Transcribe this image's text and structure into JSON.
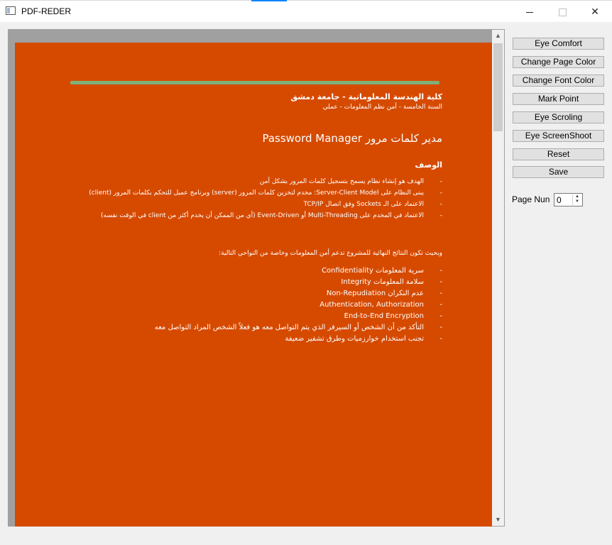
{
  "window": {
    "title": "PDF-REDER",
    "minimize_icon": "minimize-icon",
    "maximize_icon": "maximize-icon",
    "close_icon": "close-icon",
    "close_glyph": "✕"
  },
  "document": {
    "university": "كلية الهندسة المعلوماتية - جامعة دمشق",
    "year": "السنة الخامسة - أمن نظم المعلومات - عملي",
    "title": "مدير كلمات مرور Password Manager",
    "section_heading": "الوصف",
    "bullets": [
      "الهدف هو إنشاء نظام يسمح بتسجيل كلمات المرور بشكل آمن",
      "يبنى النظام على Server-Client Model: مخدم لتخزين كلمات المرور (server) وبرنامج عميل للتحكم بكلمات المرور (client)",
      "الاعتماد على الـ Sockets وفق اتصال TCP/IP",
      "الاعتماد في المخدم على Multi-Threading أو Event-Driven (أي من الممكن أن يخدم أكثر من client في الوقت نفسه)"
    ],
    "summary": "وبحيث تكون النتائج النهائية للمشروع تدعم أمن المعلومات وخاصة من النواحي التالية:",
    "security_points": [
      "سرية المعلومات Confidentiality",
      "سلامة المعلومات Integrity",
      "عدم النكران Non-Repudiation",
      "Authentication, Authorization",
      "End-to-End Encryption",
      "التأكد من أن الشخص أو السيرفر الذي يتم التواصل معه هو فعلاً الشخص المراد التواصل معه",
      "تجنب استخدام خوارزميات وطرق تشفير ضعيفة"
    ],
    "page_color": "#d64a00",
    "font_color": "#ffffff"
  },
  "scrollbar": {
    "up_icon": "scroll-up-arrow-icon",
    "down_icon": "scroll-down-arrow-icon",
    "up_glyph": "▲",
    "down_glyph": "▼"
  },
  "panel": {
    "buttons": [
      "Eye Comfort",
      "Change Page Color",
      "Change Font Color",
      "Mark Point",
      "Eye Scroling",
      "Eye ScreenShoot",
      "Reset",
      "Save"
    ],
    "page_label": "Page Nun",
    "page_value": "0",
    "spin_up": "▲",
    "spin_down": "▼"
  }
}
